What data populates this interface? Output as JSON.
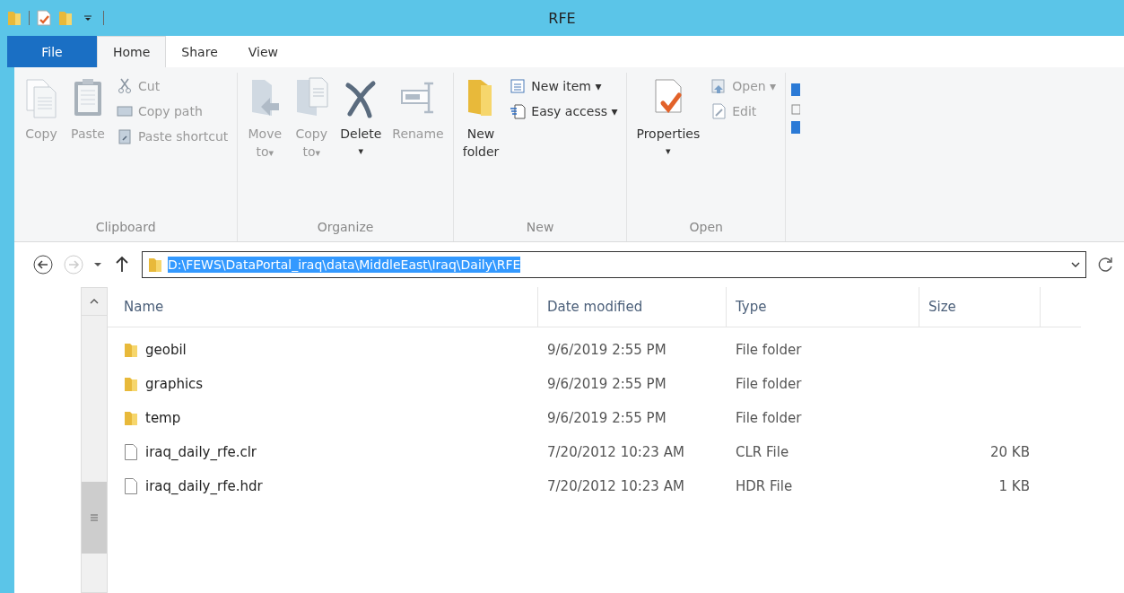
{
  "window": {
    "title": "RFE"
  },
  "file_tab": {
    "label": "File"
  },
  "tabs": [
    {
      "label": "Home",
      "selected": true
    },
    {
      "label": "Share",
      "selected": false
    },
    {
      "label": "View",
      "selected": false
    }
  ],
  "ribbon": {
    "groups": [
      {
        "label": "Clipboard",
        "large": [
          {
            "label": "Copy",
            "disabled": true
          },
          {
            "label": "Paste",
            "disabled": true
          }
        ],
        "small": [
          {
            "label": "Cut",
            "disabled": true
          },
          {
            "label": "Copy path",
            "disabled": true
          },
          {
            "label": "Paste shortcut",
            "disabled": true
          }
        ]
      },
      {
        "label": "Organize",
        "large": [
          {
            "label": "Move",
            "label2": "to",
            "caret": "▾",
            "disabled": true
          },
          {
            "label": "Copy",
            "label2": "to",
            "caret": "▾",
            "disabled": true
          },
          {
            "label": "Delete",
            "caret": "▾",
            "disabled": false
          },
          {
            "label": "Rename",
            "disabled": true
          }
        ]
      },
      {
        "label": "New",
        "large": [
          {
            "label": "New",
            "label2": "folder",
            "disabled": false
          }
        ],
        "small": [
          {
            "label": "New item ▾",
            "disabled": false
          },
          {
            "label": "Easy access ▾",
            "disabled": false
          }
        ]
      },
      {
        "label": "Open",
        "large": [
          {
            "label": "Properties",
            "caret": "▾",
            "disabled": false
          }
        ],
        "small": [
          {
            "label": "Open ▾",
            "disabled": true
          },
          {
            "label": "Edit",
            "disabled": true
          }
        ]
      }
    ]
  },
  "address": {
    "path": "D:\\FEWS\\DataPortal_iraq\\data\\MiddleEast\\Iraq\\Daily\\RFE"
  },
  "table": {
    "columns": [
      "Name",
      "Date modified",
      "Type",
      "Size"
    ],
    "rows": [
      {
        "kind": "folder",
        "name": "geobil",
        "date": "9/6/2019 2:55 PM",
        "type": "File folder"
      },
      {
        "kind": "folder",
        "name": "graphics",
        "date": "9/6/2019 2:55 PM",
        "type": "File folder"
      },
      {
        "kind": "folder",
        "name": "temp",
        "date": "9/6/2019 2:55 PM",
        "type": "File folder"
      },
      {
        "kind": "file",
        "name": "iraq_daily_rfe.clr",
        "date": "7/20/2012 10:23 AM",
        "type": "CLR File",
        "size": "20 KB"
      },
      {
        "kind": "file",
        "name": "iraq_daily_rfe.hdr",
        "date": "7/20/2012 10:23 AM",
        "type": "HDR File",
        "size": "1 KB"
      }
    ]
  }
}
